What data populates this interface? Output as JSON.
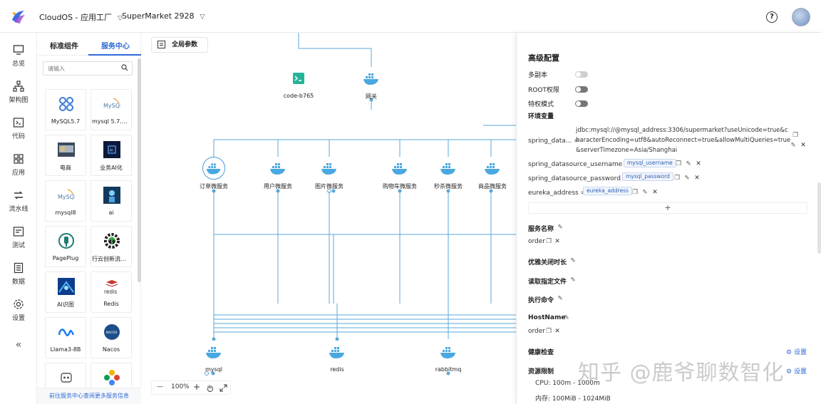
{
  "header": {
    "project": "CloudOS - 应用工厂",
    "app": "SuperMarket 2928",
    "help_icon": "help-circle-icon",
    "avatar_icon": "user-avatar"
  },
  "nav": [
    {
      "label": "总览",
      "icon": "monitor-icon"
    },
    {
      "label": "架构图",
      "icon": "architecture-icon"
    },
    {
      "label": "代码",
      "icon": "code-icon"
    },
    {
      "label": "应用",
      "icon": "apps-icon"
    },
    {
      "label": "流水线",
      "icon": "pipeline-icon"
    },
    {
      "label": "测试",
      "icon": "test-icon"
    },
    {
      "label": "数据",
      "icon": "data-icon"
    },
    {
      "label": "设置",
      "icon": "settings-icon"
    },
    {
      "label": "«",
      "icon": "collapse-icon"
    }
  ],
  "palette": {
    "tabs": [
      "标准组件",
      "服务中心"
    ],
    "active_tab": 1,
    "search_placeholder": "请输入",
    "footer": "前往服务中心查阅更多服务信息",
    "items": [
      {
        "label": "MySQL5.7"
      },
      {
        "label": "mysql 5.7.29 ..."
      },
      {
        "label": "电商"
      },
      {
        "label": "业务AI化"
      },
      {
        "label": "mysql8"
      },
      {
        "label": "ai"
      },
      {
        "label": "PagePlug"
      },
      {
        "label": "行云创新流程..."
      },
      {
        "label": "AI识图"
      },
      {
        "label": "Redis"
      },
      {
        "label": "Llama3-8B"
      },
      {
        "label": "Nacos"
      },
      {
        "label": ""
      },
      {
        "label": ""
      }
    ],
    "icon_text": {
      "mysql": "MySQL",
      "ai": "AI",
      "redis": "redis",
      "nacos": "NACOS"
    }
  },
  "canvas": {
    "global_params": "全局参数",
    "nodes": [
      {
        "label": "code-b765"
      },
      {
        "label": "网关"
      },
      {
        "label": "订单微服务"
      },
      {
        "label": "用户微服务"
      },
      {
        "label": "图片微服务"
      },
      {
        "label": "购物车微服务"
      },
      {
        "label": "秒杀微服务"
      },
      {
        "label": "商品微服务"
      },
      {
        "label": "mysql"
      },
      {
        "label": "redis"
      },
      {
        "label": "rabbitmq"
      }
    ],
    "zoom": {
      "minus": "—",
      "value": "100%",
      "plus": "+"
    }
  },
  "panel": {
    "title": "高级配置",
    "toggles": [
      {
        "label": "多副本",
        "on": false
      },
      {
        "label": "ROOT权限",
        "on": false
      },
      {
        "label": "特权模式",
        "on": false
      }
    ],
    "env_title": "环境变量",
    "env": [
      {
        "key": "spring_data... =",
        "value": "jdbc:mysql://@mysql_address:3306/supermarket?useUnicode=true&characterEncoding=utf8&autoReconnect=true&allowMultiQueries=true&serverTimezone=Asia/Shanghai"
      },
      {
        "key": "spring_datasource_username =",
        "tag": "mysql_username"
      },
      {
        "key": "spring_datasource_password =",
        "tag": "mysql_password"
      },
      {
        "key": "eureka_address =",
        "tag": "eureka_address"
      }
    ],
    "add": "+",
    "service_name_label": "服务名称",
    "service_name_value": "order",
    "graceful_label": "优雅关闭时长",
    "readfile_label": "读取指定文件",
    "command_label": "执行命令",
    "hostname_label": "HostName",
    "hostname_value": "order",
    "health_label": "健康检查",
    "health_set": "设置",
    "resource_label": "资源限制",
    "resource_set": "设置",
    "cpu": "CPU: 100m - 1000m",
    "mem": "内存: 100MiB - 1024MiB",
    "watermark": "知乎 @鹿爷聊数智化"
  },
  "colors": {
    "accent": "#2e6bd8",
    "line": "#5aa7d8",
    "docker": "#4aa8e0"
  }
}
